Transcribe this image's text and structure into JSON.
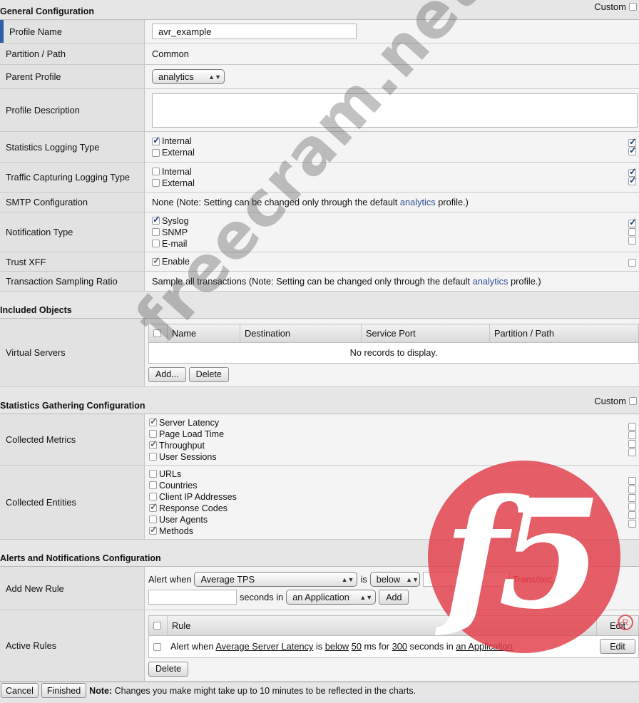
{
  "custom_label": "Custom",
  "general": {
    "title": "General Configuration",
    "profile_name": {
      "label": "Profile Name",
      "value": "avr_example"
    },
    "partition": {
      "label": "Partition / Path",
      "value": "Common"
    },
    "parent": {
      "label": "Parent Profile",
      "value": "analytics"
    },
    "description": {
      "label": "Profile Description",
      "value": ""
    },
    "stats_logging": {
      "label": "Statistics Logging Type",
      "options": [
        {
          "label": "Internal",
          "checked": true
        },
        {
          "label": "External",
          "checked": false
        }
      ]
    },
    "traffic_logging": {
      "label": "Traffic Capturing Logging Type",
      "options": [
        {
          "label": "Internal",
          "checked": false
        },
        {
          "label": "External",
          "checked": false
        }
      ]
    },
    "smtp": {
      "label": "SMTP Configuration",
      "prefix": "None (Note: Setting can be changed only through the default ",
      "link": "analytics",
      "suffix": " profile.)"
    },
    "notification": {
      "label": "Notification Type",
      "options": [
        {
          "label": "Syslog",
          "checked": true
        },
        {
          "label": "SNMP",
          "checked": false
        },
        {
          "label": "E-mail",
          "checked": false
        }
      ]
    },
    "trust_xff": {
      "label": "Trust XFF",
      "option": "Enable",
      "checked": true
    },
    "sampling": {
      "label": "Transaction Sampling Ratio",
      "prefix": "Sample all transactions (Note: Setting can be changed only through the default ",
      "link": "analytics",
      "suffix": " profile.)"
    }
  },
  "included": {
    "title": "Included Objects",
    "virtual_servers": {
      "label": "Virtual Servers",
      "columns": [
        "Name",
        "Destination",
        "Service Port",
        "Partition / Path"
      ],
      "empty": "No records to display.",
      "add": "Add...",
      "delete": "Delete"
    }
  },
  "stats": {
    "title": "Statistics Gathering Configuration",
    "metrics": {
      "label": "Collected Metrics",
      "options": [
        {
          "label": "Server Latency",
          "checked": true
        },
        {
          "label": "Page Load Time",
          "checked": false
        },
        {
          "label": "Throughput",
          "checked": true
        },
        {
          "label": "User Sessions",
          "checked": false
        }
      ]
    },
    "entities": {
      "label": "Collected Entities",
      "options": [
        {
          "label": "URLs",
          "checked": false
        },
        {
          "label": "Countries",
          "checked": false
        },
        {
          "label": "Client IP Addresses",
          "checked": false
        },
        {
          "label": "Response Codes",
          "checked": true
        },
        {
          "label": "User Agents",
          "checked": false
        },
        {
          "label": "Methods",
          "checked": true
        }
      ]
    }
  },
  "alerts": {
    "title": "Alerts and Notifications Configuration",
    "new_rule": {
      "label": "Add New Rule",
      "alert_when": "Alert when",
      "metric": "Average TPS",
      "is": "is",
      "direction": "below",
      "unit": "Trans/sec, for",
      "seconds_in": "seconds in",
      "scope": "an Application",
      "add": "Add"
    },
    "active": {
      "label": "Active Rules",
      "col_rule": "Rule",
      "col_edit": "Edit",
      "rule_prefix": "Alert when ",
      "rule_metric": "Average Server Latency",
      "rule_is": " is ",
      "rule_dir": "below",
      "rule_sp": " ",
      "rule_value": "50",
      "rule_ms": " ms for ",
      "rule_secs": "300",
      "rule_in": " seconds in ",
      "rule_scope": "an Application",
      "rule_end": ".",
      "edit_btn": "Edit",
      "delete": "Delete"
    }
  },
  "footer": {
    "cancel": "Cancel",
    "finished": "Finished",
    "note_bold": "Note:",
    "note": " Changes you make might take up to 10 minutes to be reflected in the charts."
  },
  "watermark": "freecram.net",
  "logo": {
    "text": "f5",
    "reg": "R"
  }
}
